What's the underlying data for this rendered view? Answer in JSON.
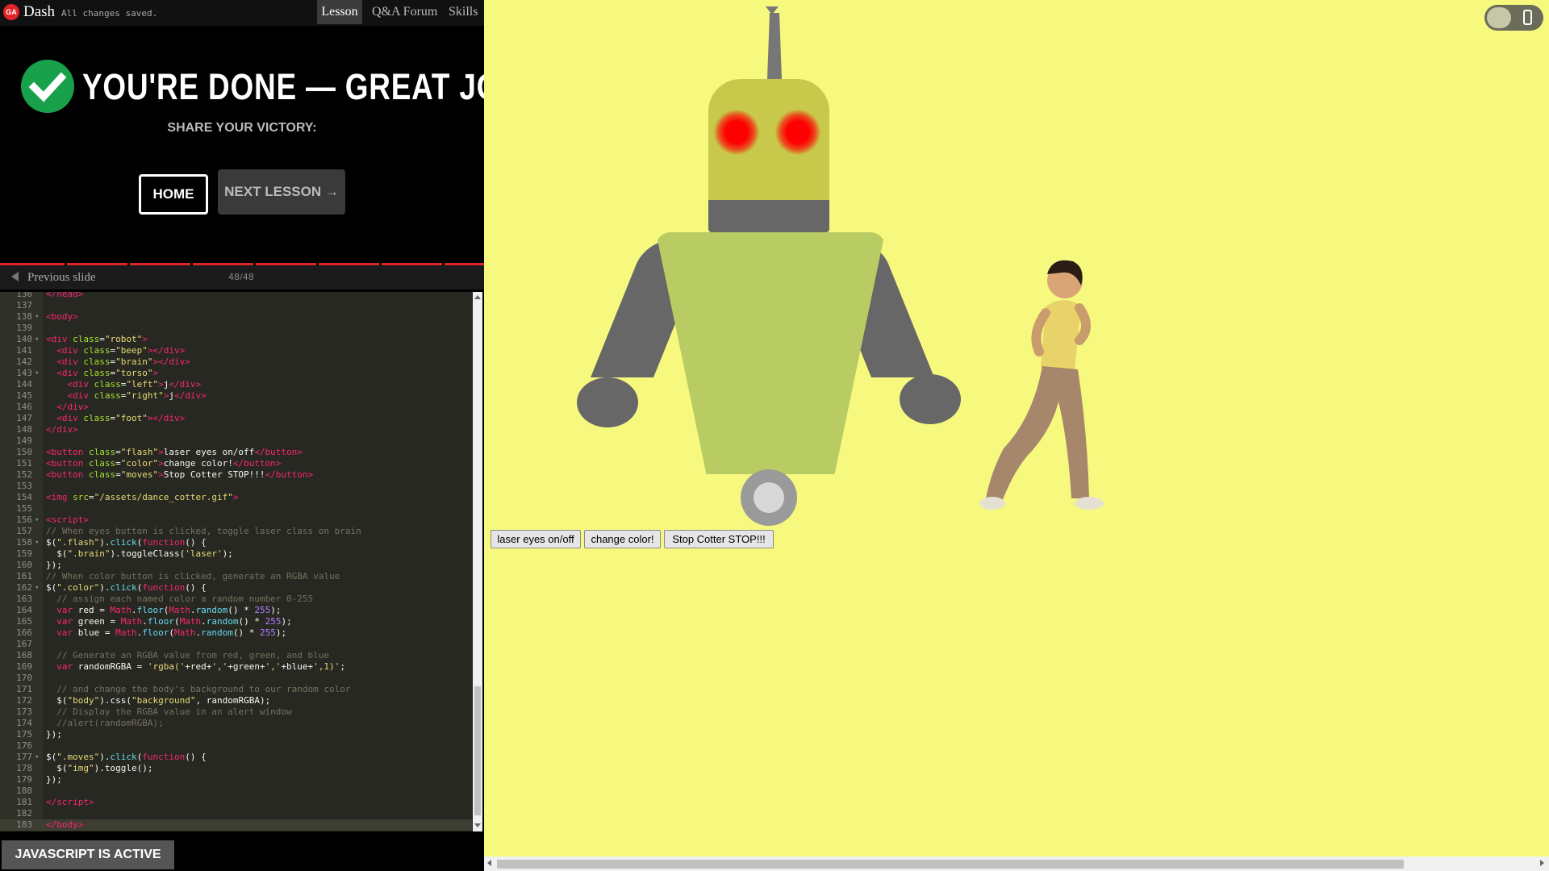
{
  "app": {
    "logo_text": "GA",
    "title": "Dash",
    "save_status": "All changes saved."
  },
  "nav": {
    "tabs": [
      {
        "label": "Lesson",
        "active": true
      },
      {
        "label": "Q&A Forum"
      },
      {
        "label": "Skills"
      }
    ]
  },
  "lesson": {
    "done_title": "YOU'RE DONE — GREAT JOB!",
    "share_label": "SHARE YOUR VICTORY:",
    "home_label": "HOME",
    "next_label": "NEXT LESSON →",
    "prev_slide_label": "Previous slide",
    "slide_counter": "48/48",
    "progress_percent": 100
  },
  "editor": {
    "lines": [
      {
        "n": "136",
        "fold": false,
        "html": "<span class=\"t\">&lt;/head&gt;</span>"
      },
      {
        "n": "137",
        "fold": false,
        "html": ""
      },
      {
        "n": "138",
        "fold": true,
        "html": "<span class=\"t\">&lt;body&gt;</span>"
      },
      {
        "n": "139",
        "fold": false,
        "html": ""
      },
      {
        "n": "140",
        "fold": true,
        "html": "<span class=\"t\">&lt;div </span><span class=\"a\">class</span>=<span class=\"s\">\"robot\"</span><span class=\"t\">&gt;</span>"
      },
      {
        "n": "141",
        "fold": false,
        "html": "  <span class=\"t\">&lt;div </span><span class=\"a\">class</span>=<span class=\"s\">\"beep\"</span><span class=\"t\">&gt;&lt;/div&gt;</span>"
      },
      {
        "n": "142",
        "fold": false,
        "html": "  <span class=\"t\">&lt;div </span><span class=\"a\">class</span>=<span class=\"s\">\"brain\"</span><span class=\"t\">&gt;&lt;/div&gt;</span>"
      },
      {
        "n": "143",
        "fold": true,
        "html": "  <span class=\"t\">&lt;div </span><span class=\"a\">class</span>=<span class=\"s\">\"torso\"</span><span class=\"t\">&gt;</span>"
      },
      {
        "n": "144",
        "fold": false,
        "html": "    <span class=\"t\">&lt;div </span><span class=\"a\">class</span>=<span class=\"s\">\"left\"</span><span class=\"t\">&gt;</span>j<span class=\"t\">&lt;/div&gt;</span>"
      },
      {
        "n": "145",
        "fold": false,
        "html": "    <span class=\"t\">&lt;div </span><span class=\"a\">class</span>=<span class=\"s\">\"right\"</span><span class=\"t\">&gt;</span>j<span class=\"t\">&lt;/div&gt;</span>"
      },
      {
        "n": "146",
        "fold": false,
        "html": "  <span class=\"t\">&lt;/div&gt;</span>"
      },
      {
        "n": "147",
        "fold": false,
        "html": "  <span class=\"t\">&lt;div </span><span class=\"a\">class</span>=<span class=\"s\">\"foot\"</span><span class=\"t\">&gt;&lt;/div&gt;</span>"
      },
      {
        "n": "148",
        "fold": false,
        "html": "<span class=\"t\">&lt;/div&gt;</span>"
      },
      {
        "n": "149",
        "fold": false,
        "html": ""
      },
      {
        "n": "150",
        "fold": false,
        "html": "<span class=\"t\">&lt;button </span><span class=\"a\">class</span>=<span class=\"s\">\"flash\"</span><span class=\"t\">&gt;</span>laser eyes on/off<span class=\"t\">&lt;/button&gt;</span>"
      },
      {
        "n": "151",
        "fold": false,
        "html": "<span class=\"t\">&lt;button </span><span class=\"a\">class</span>=<span class=\"s\">\"color\"</span><span class=\"t\">&gt;</span>change color!<span class=\"t\">&lt;/button&gt;</span>"
      },
      {
        "n": "152",
        "fold": false,
        "html": "<span class=\"t\">&lt;button </span><span class=\"a\">class</span>=<span class=\"s\">\"moves\"</span><span class=\"t\">&gt;</span>Stop Cotter STOP!!!<span class=\"t\">&lt;/button&gt;</span>"
      },
      {
        "n": "153",
        "fold": false,
        "html": ""
      },
      {
        "n": "154",
        "fold": false,
        "html": "<span class=\"t\">&lt;img </span><span class=\"a\">src</span>=<span class=\"s\">\"/assets/dance_cotter.gif\"</span><span class=\"t\">&gt;</span>"
      },
      {
        "n": "155",
        "fold": false,
        "html": ""
      },
      {
        "n": "156",
        "fold": true,
        "html": "<span class=\"t\">&lt;script&gt;</span>"
      },
      {
        "n": "157",
        "fold": false,
        "html": "<span class=\"c\">// When eyes button is clicked, toggle laser class on brain</span>"
      },
      {
        "n": "158",
        "fold": true,
        "html": "$(<span class=\"s\">\".flash\"</span>).<span class=\"f\">click</span>(<span class=\"t\">function</span>() {"
      },
      {
        "n": "159",
        "fold": false,
        "html": "  $(<span class=\"s\">\".brain\"</span>).toggleClass(<span class=\"s\">'laser'</span>);"
      },
      {
        "n": "160",
        "fold": false,
        "html": "});"
      },
      {
        "n": "161",
        "fold": false,
        "html": "<span class=\"c\">// When color button is clicked, generate an RGBA value</span>"
      },
      {
        "n": "162",
        "fold": true,
        "html": "$(<span class=\"s\">\".color\"</span>).<span class=\"f\">click</span>(<span class=\"t\">function</span>() {"
      },
      {
        "n": "163",
        "fold": false,
        "html": "  <span class=\"c\">// assign each named color a random number 0-255</span>"
      },
      {
        "n": "164",
        "fold": false,
        "html": "  <span class=\"t\">var</span> red = <span class=\"t\">Math</span>.<span class=\"f\">floor</span>(<span class=\"t\">Math</span>.<span class=\"f\">random</span>() * <span class=\"n\">255</span>);"
      },
      {
        "n": "165",
        "fold": false,
        "html": "  <span class=\"t\">var</span> green = <span class=\"t\">Math</span>.<span class=\"f\">floor</span>(<span class=\"t\">Math</span>.<span class=\"f\">random</span>() * <span class=\"n\">255</span>);"
      },
      {
        "n": "166",
        "fold": false,
        "html": "  <span class=\"t\">var</span> blue = <span class=\"t\">Math</span>.<span class=\"f\">floor</span>(<span class=\"t\">Math</span>.<span class=\"f\">random</span>() * <span class=\"n\">255</span>);"
      },
      {
        "n": "167",
        "fold": false,
        "html": ""
      },
      {
        "n": "168",
        "fold": false,
        "html": "  <span class=\"c\">// Generate an RGBA value from red, green, and blue</span>"
      },
      {
        "n": "169",
        "fold": false,
        "html": "  <span class=\"t\">var</span> randomRGBA = <span class=\"s\">'rgba('</span>+red+<span class=\"s\">','</span>+green+<span class=\"s\">','</span>+blue+<span class=\"s\">',1)'</span>;"
      },
      {
        "n": "170",
        "fold": false,
        "html": ""
      },
      {
        "n": "171",
        "fold": false,
        "html": "  <span class=\"c\">// and change the body's background to our random color</span>"
      },
      {
        "n": "172",
        "fold": false,
        "html": "  $(<span class=\"s\">\"body\"</span>).css(<span class=\"s\">\"background\"</span>, randomRGBA);"
      },
      {
        "n": "173",
        "fold": false,
        "html": "  <span class=\"c\">// Display the RGBA value in an alert window</span>"
      },
      {
        "n": "174",
        "fold": false,
        "html": "  <span class=\"c\">//alert(randomRGBA);</span>"
      },
      {
        "n": "175",
        "fold": false,
        "html": "});"
      },
      {
        "n": "176",
        "fold": false,
        "html": ""
      },
      {
        "n": "177",
        "fold": true,
        "html": "$(<span class=\"s\">\".moves\"</span>).<span class=\"f\">click</span>(<span class=\"t\">function</span>() {"
      },
      {
        "n": "178",
        "fold": false,
        "html": "  $(<span class=\"s\">\"img\"</span>).toggle();"
      },
      {
        "n": "179",
        "fold": false,
        "html": "});"
      },
      {
        "n": "180",
        "fold": false,
        "html": ""
      },
      {
        "n": "181",
        "fold": false,
        "html": "<span class=\"t\">&lt;/script&gt;</span>"
      },
      {
        "n": "182",
        "fold": false,
        "html": ""
      },
      {
        "n": "183",
        "fold": false,
        "html": "<span class=\"t\">&lt;/body&gt;</span>",
        "active": true
      }
    ]
  },
  "status": {
    "js_label": "JAVASCRIPT IS ACTIVE"
  },
  "preview": {
    "buttons": {
      "laser": "laser eyes on/off",
      "color": "change color!",
      "moves": "Stop Cotter STOP!!!"
    },
    "background_color": "#f7f97f"
  },
  "colors": {
    "accent": "#e1242a",
    "check": "#18a04a",
    "robot_head": "#c8c84a",
    "robot_torso": "#b9cc64",
    "robot_limbs": "#676767"
  }
}
